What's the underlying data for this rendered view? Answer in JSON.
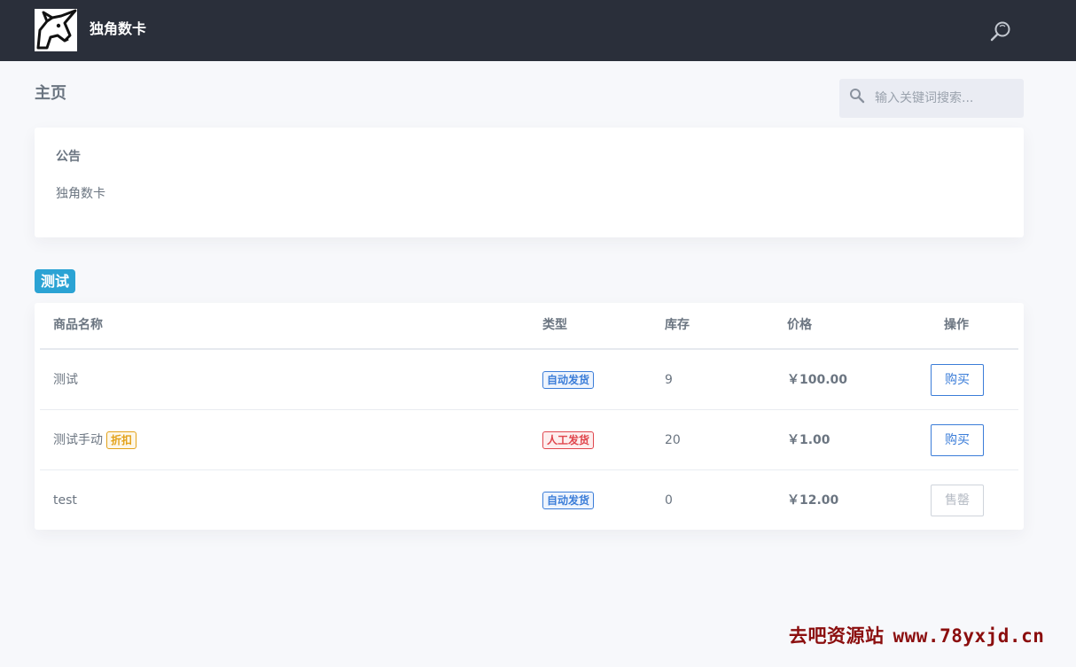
{
  "header": {
    "brand": "独角数卡",
    "logo_icon": "unicorn-logo-icon",
    "search_icon": "search-icon"
  },
  "page": {
    "title": "主页"
  },
  "search": {
    "placeholder": "输入关键词搜索..."
  },
  "notice": {
    "title": "公告",
    "body": "独角数卡"
  },
  "category": {
    "name": "测试",
    "color": "#2ba3d4"
  },
  "table": {
    "headers": {
      "name": "商品名称",
      "type": "类型",
      "stock": "库存",
      "price": "价格",
      "action": "操作"
    },
    "rows": [
      {
        "name": "测试",
        "discount": "",
        "type": "自动发货",
        "stock": "9",
        "price": "￥100.00",
        "action": "购买"
      },
      {
        "name": "测试手动",
        "discount": "折扣",
        "type": "人工发货",
        "stock": "20",
        "price": "￥1.00",
        "action": "购买"
      },
      {
        "name": "test",
        "discount": "",
        "type": "自动发货",
        "stock": "0",
        "price": "￥12.00",
        "action": "售罄"
      }
    ]
  },
  "colors": {
    "topbar": "#2a2f3a",
    "accent": "#3b7dd8",
    "manual": "#e0464d",
    "discount": "#e3a21a"
  },
  "watermark": {
    "name": "去吧资源站",
    "url": "www.78yxjd.cn"
  }
}
